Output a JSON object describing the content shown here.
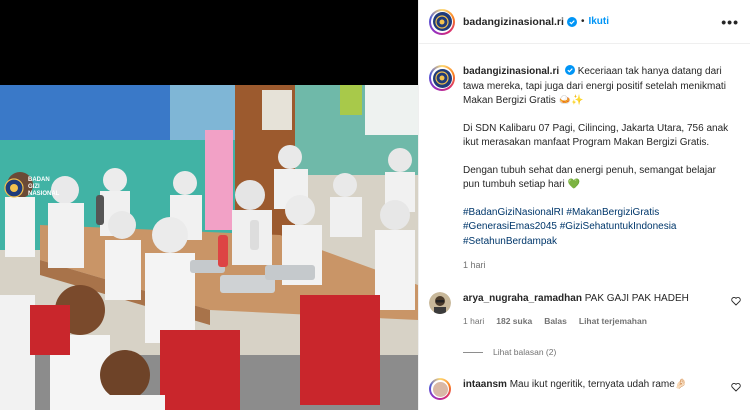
{
  "header": {
    "username": "badangizinasional.ri",
    "separator": "•",
    "follow_label": "Ikuti",
    "more_label": "•••"
  },
  "photo": {
    "wall_logo_text": "BADAN\nGIZI\nNASIONAL"
  },
  "caption": {
    "username": "badangizinasional.ri",
    "paragraph1": "Keceriaan tak hanya datang dari tawa mereka, tapi juga dari energi positif setelah menikmati Makan Bergizi Gratis 🍛✨",
    "paragraph2": "Di SDN Kalibaru 07 Pagi, Cilincing, Jakarta Utara, 756 anak ikut merasakan manfaat Program Makan Bergizi Gratis.",
    "paragraph3": "Dengan tubuh sehat dan energi penuh, semangat belajar pun tumbuh setiap hari 💚",
    "hashtags": [
      "#BadanGiziNasionalRI",
      "#MakanBergiziGratis",
      "#GenerasiEmas2045",
      "#GiziSehatuntukIndonesia",
      "#SetahunBerdampak"
    ],
    "time": "1 hari"
  },
  "comments": [
    {
      "username": "arya_nugraha_ramadhan",
      "text": "PAK GAJI PAK HADEH",
      "time": "1 hari",
      "likes": "182 suka",
      "reply_label": "Balas",
      "translate_label": "Lihat terjemahan",
      "view_replies": "Lihat balasan (2)"
    },
    {
      "username": "intaansm",
      "text": "Mau ikut ngeritik, ternyata udah rame🤌🏻"
    }
  ],
  "colors": {
    "accent": "#0095f6",
    "hashtag": "#00376b",
    "muted": "#737373",
    "verified": "#0095f6"
  },
  "icons": {
    "verified": "verified-badge-icon",
    "heart": "heart-outline-icon",
    "more": "more-options-icon"
  }
}
